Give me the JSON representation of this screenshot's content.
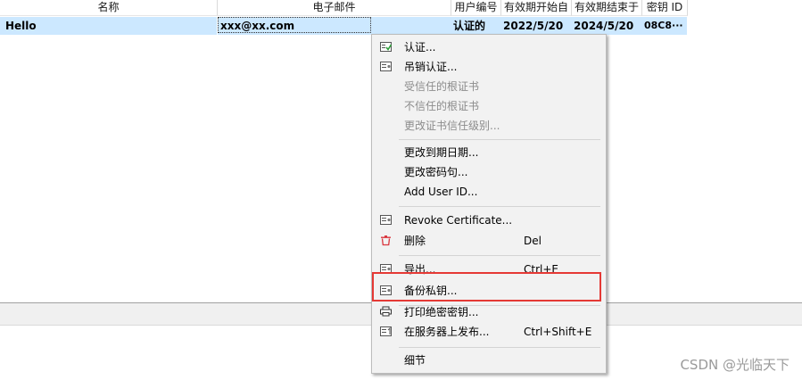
{
  "table": {
    "columns": [
      "名称",
      "电子邮件",
      "用户编号",
      "有效期开始自",
      "有效期结束于",
      "密钥 ID"
    ],
    "row": {
      "name": "Hello",
      "email": "xxx@xx.com",
      "user_id": "认证的",
      "valid_from": "2022/5/20",
      "valid_until": "2024/5/20",
      "key_id": "08C8···"
    }
  },
  "menu": {
    "items": [
      {
        "label": "认证...",
        "icon": "certify-icon",
        "enabled": true
      },
      {
        "label": "吊销认证...",
        "icon": "revoke-certification-icon",
        "enabled": true
      },
      {
        "label": "受信任的根证书",
        "enabled": false
      },
      {
        "label": "不信任的根证书",
        "enabled": false
      },
      {
        "label": "更改证书信任级别...",
        "enabled": false
      },
      {
        "label": "更改到期日期...",
        "enabled": true
      },
      {
        "label": "更改密码句...",
        "enabled": true
      },
      {
        "label": "Add User ID...",
        "enabled": true
      },
      {
        "label": "Revoke Certificate...",
        "icon": "revoke-certificate-icon",
        "enabled": true
      },
      {
        "label": "删除",
        "icon": "trash-icon",
        "shortcut": "Del",
        "enabled": true
      },
      {
        "label": "导出...",
        "icon": "export-icon",
        "shortcut": "Ctrl+E",
        "enabled": true
      },
      {
        "label": "备份私钥...",
        "icon": "backup-key-icon",
        "enabled": true,
        "highlighted": true
      },
      {
        "label": "打印绝密密钥...",
        "icon": "printer-icon",
        "enabled": true
      },
      {
        "label": "在服务器上发布...",
        "icon": "publish-icon",
        "shortcut": "Ctrl+Shift+E",
        "enabled": true
      },
      {
        "label": "细节",
        "enabled": true
      }
    ]
  },
  "watermark": "CSDN @光临天下",
  "colors": {
    "row_selected": "#cce8ff",
    "menu_bg": "#f2f2f2",
    "highlight_border": "#e53935",
    "disabled_text": "#8c8c8c"
  }
}
